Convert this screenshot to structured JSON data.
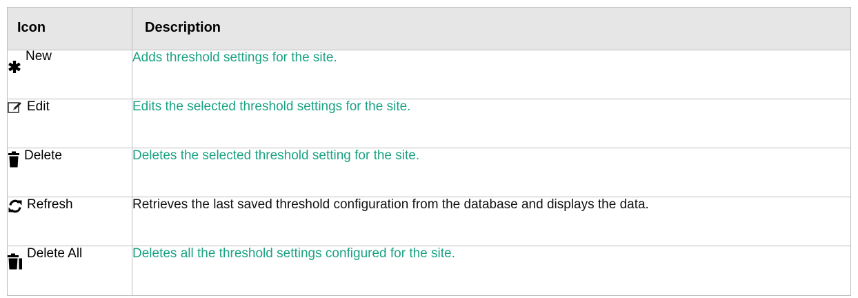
{
  "table": {
    "headers": {
      "icon": "Icon",
      "description": "Description"
    },
    "rows": [
      {
        "icon": "asterisk-icon",
        "label": "New",
        "description": "Adds threshold settings for the site.",
        "linked": true
      },
      {
        "icon": "edit-icon",
        "label": "Edit",
        "description": "Edits the selected threshold settings for the site.",
        "linked": true
      },
      {
        "icon": "trash-icon",
        "label": "Delete",
        "description": "Deletes the selected threshold setting for the site.",
        "linked": true
      },
      {
        "icon": "refresh-icon",
        "label": "Refresh",
        "description": "Retrieves the last saved threshold configuration from the database and displays the data.",
        "linked": false
      },
      {
        "icon": "trash-all-icon",
        "label": "Delete All",
        "description": "Deletes all the threshold settings configured for the site.",
        "linked": true
      }
    ]
  },
  "colors": {
    "link": "#1aa283",
    "header_bg": "#e6e6e6",
    "border": "#bbbbbb"
  }
}
